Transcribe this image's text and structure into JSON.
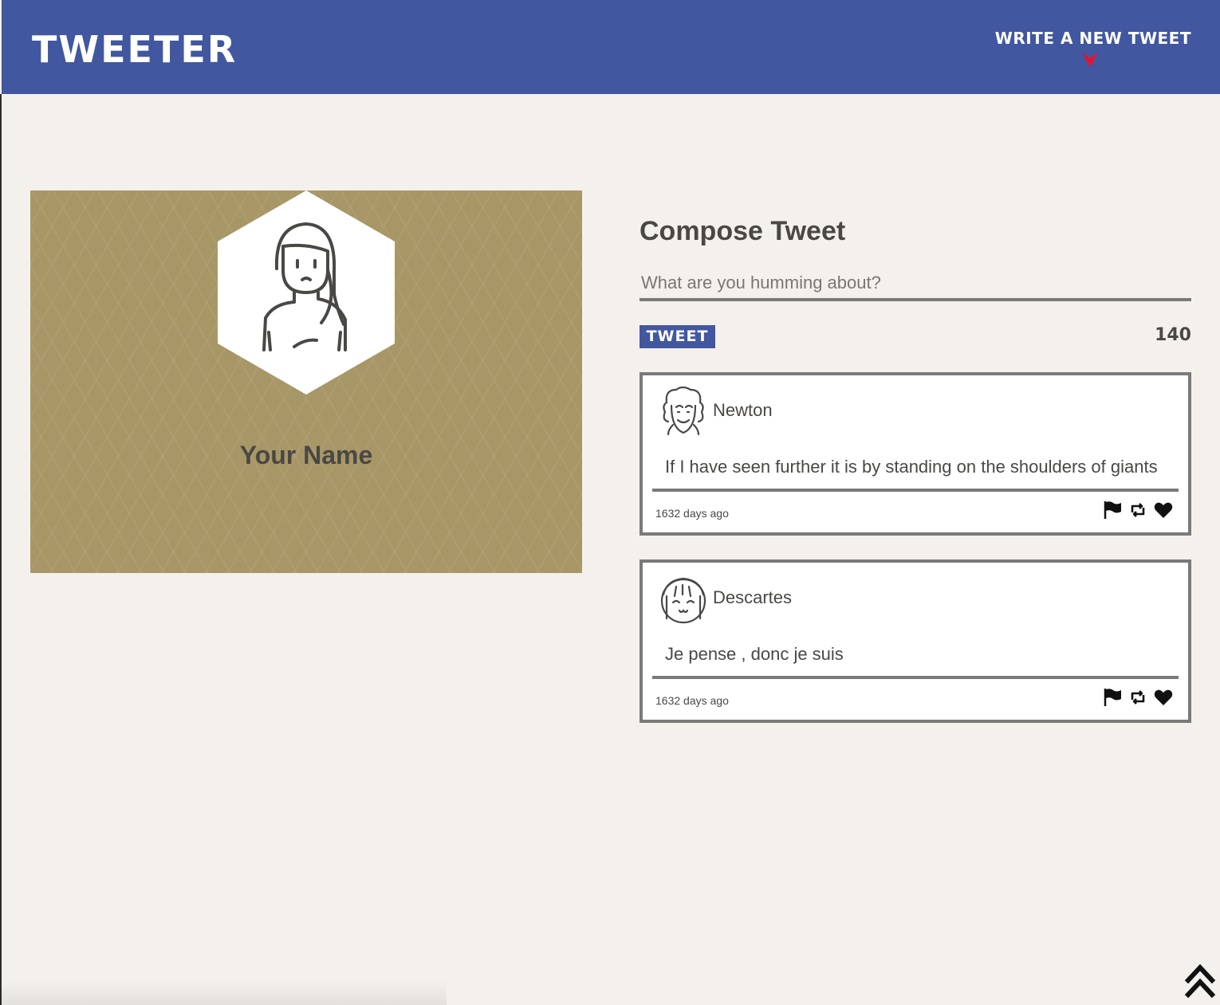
{
  "nav": {
    "logo": "TWEETER",
    "write_new": "WRITE A NEW TWEET",
    "arrow_icon": "arrow-down-icon"
  },
  "profile": {
    "name": "Your Name",
    "avatar_icon": "user-avatar-icon"
  },
  "compose": {
    "title": "Compose Tweet",
    "placeholder": "What are you humming about?",
    "button_label": "TWEET",
    "counter": "140"
  },
  "tweets": [
    {
      "handle": "Newton",
      "content": "If I have seen further it is by standing on the shoulders of giants",
      "age": "1632 days ago"
    },
    {
      "handle": "Descartes",
      "content": "Je pense , donc je suis",
      "age": "1632 days ago"
    }
  ],
  "colors": {
    "nav_bg": "#4157a0",
    "page_bg": "#f4f1ed",
    "profile_bg": "#a89766",
    "text": "#4a4845",
    "arrow": "#e8112d"
  }
}
